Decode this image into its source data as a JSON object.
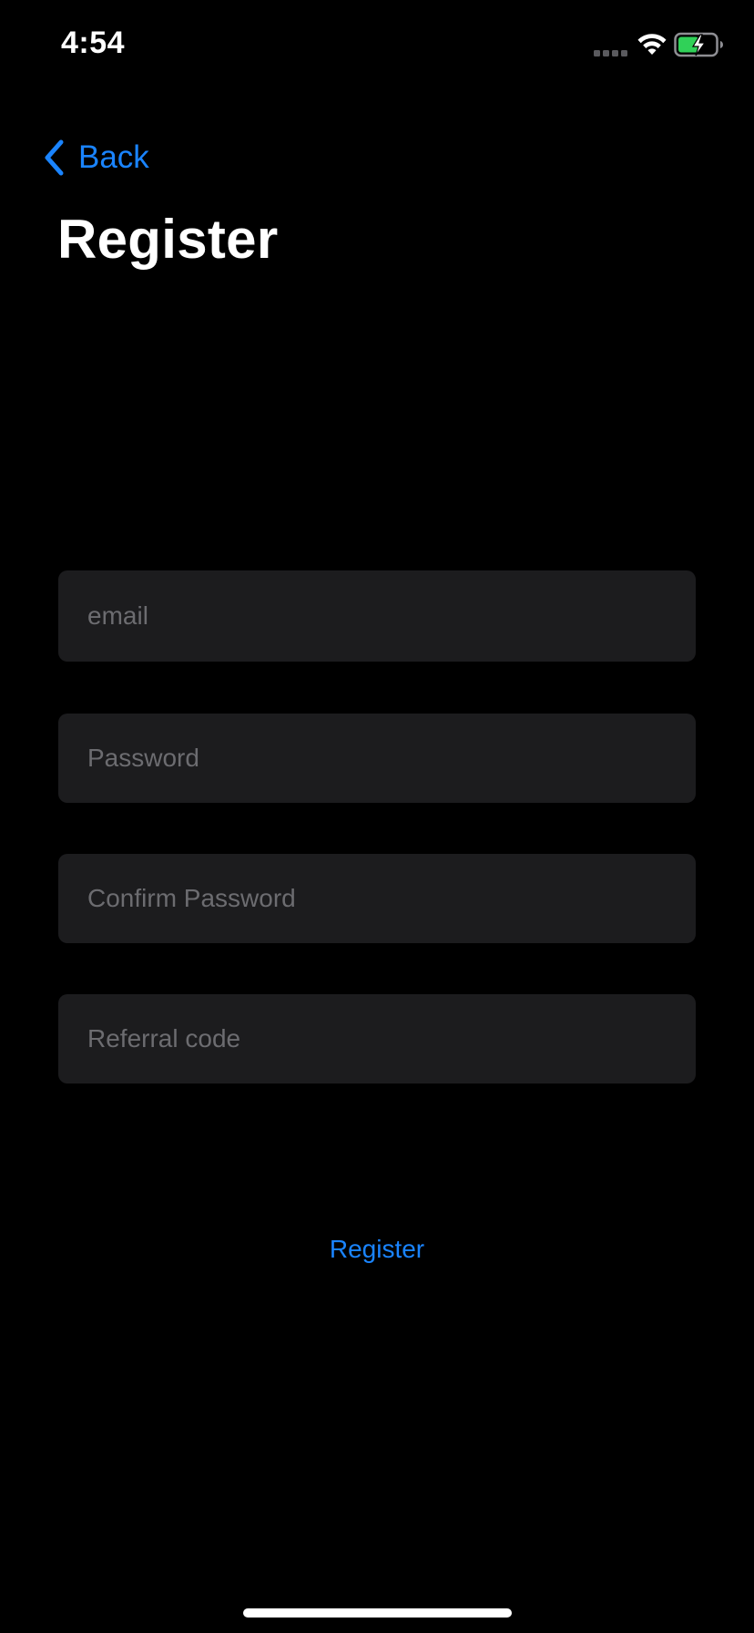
{
  "status_bar": {
    "time": "4:54",
    "icons": [
      "cellular-signal-icon",
      "wifi-icon",
      "battery-charging-icon"
    ]
  },
  "nav": {
    "back_label": "Back",
    "title": "Register"
  },
  "form": {
    "email": {
      "placeholder": "email",
      "value": ""
    },
    "password": {
      "placeholder": "Password",
      "value": ""
    },
    "confirm_password": {
      "placeholder": "Confirm Password",
      "value": ""
    },
    "referral_code": {
      "placeholder": "Referral code",
      "value": ""
    }
  },
  "actions": {
    "register_label": "Register"
  },
  "colors": {
    "background": "#000000",
    "accent": "#1a84ff",
    "field_background": "#1c1c1e",
    "placeholder": "#6c6c70",
    "battery_fill": "#30d158"
  }
}
